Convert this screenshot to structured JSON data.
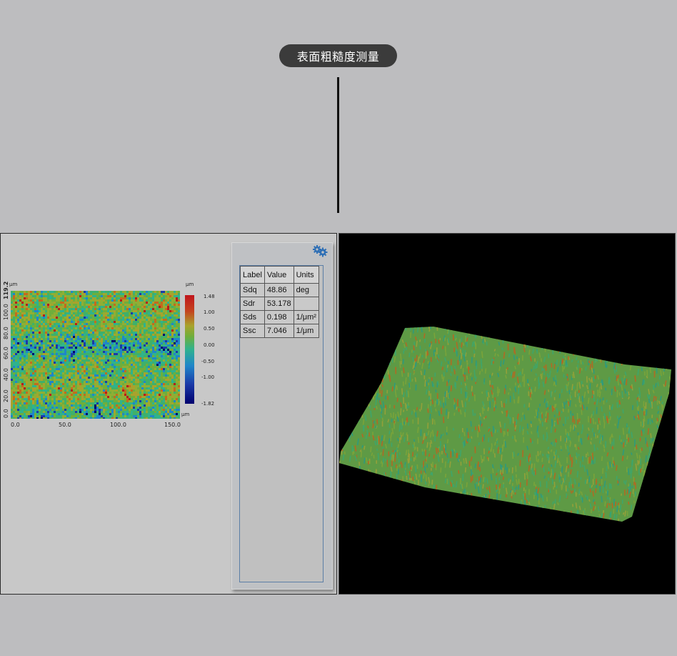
{
  "page_title": "表面粗糙度测量",
  "height_map": {
    "y_unit": "μm",
    "x_unit": "μm",
    "z_unit": "μm",
    "y_max_label": "119.2",
    "y_ticks": [
      "0.0",
      "20.0",
      "40.0",
      "60.0",
      "80.0",
      "100.0"
    ],
    "x_ticks": [
      "0.0",
      "50.0",
      "100.0",
      "150.0"
    ],
    "colorbar_ticks": [
      "1.48",
      "1.00",
      "0.50",
      "0.00",
      "-0.50",
      "-1.00",
      "-1.82"
    ],
    "colorbar_range": [
      -1.82,
      1.48
    ],
    "colors": [
      "#00006e",
      "#1b3aa8",
      "#1f86c9",
      "#2fb28e",
      "#6fae3b",
      "#a9a22c",
      "#c46a1e",
      "#b71c1c"
    ]
  },
  "param_table": {
    "gear_icon": "gear-icon",
    "headers": [
      "Label",
      "Value",
      "Units"
    ],
    "rows": [
      {
        "label": "Sdq",
        "value": "48.86",
        "units": "deg"
      },
      {
        "label": "Sdr",
        "value": "53.178",
        "units": ""
      },
      {
        "label": "Sds",
        "value": "0.198",
        "units": "1/μm²"
      },
      {
        "label": "Ssc",
        "value": "7.046",
        "units": "1/μm"
      }
    ]
  },
  "surface_3d": {
    "background": "#000000",
    "colors": [
      "#3fa56a",
      "#7aa33a",
      "#b06a24",
      "#2f9a7c",
      "#93a03a"
    ]
  }
}
